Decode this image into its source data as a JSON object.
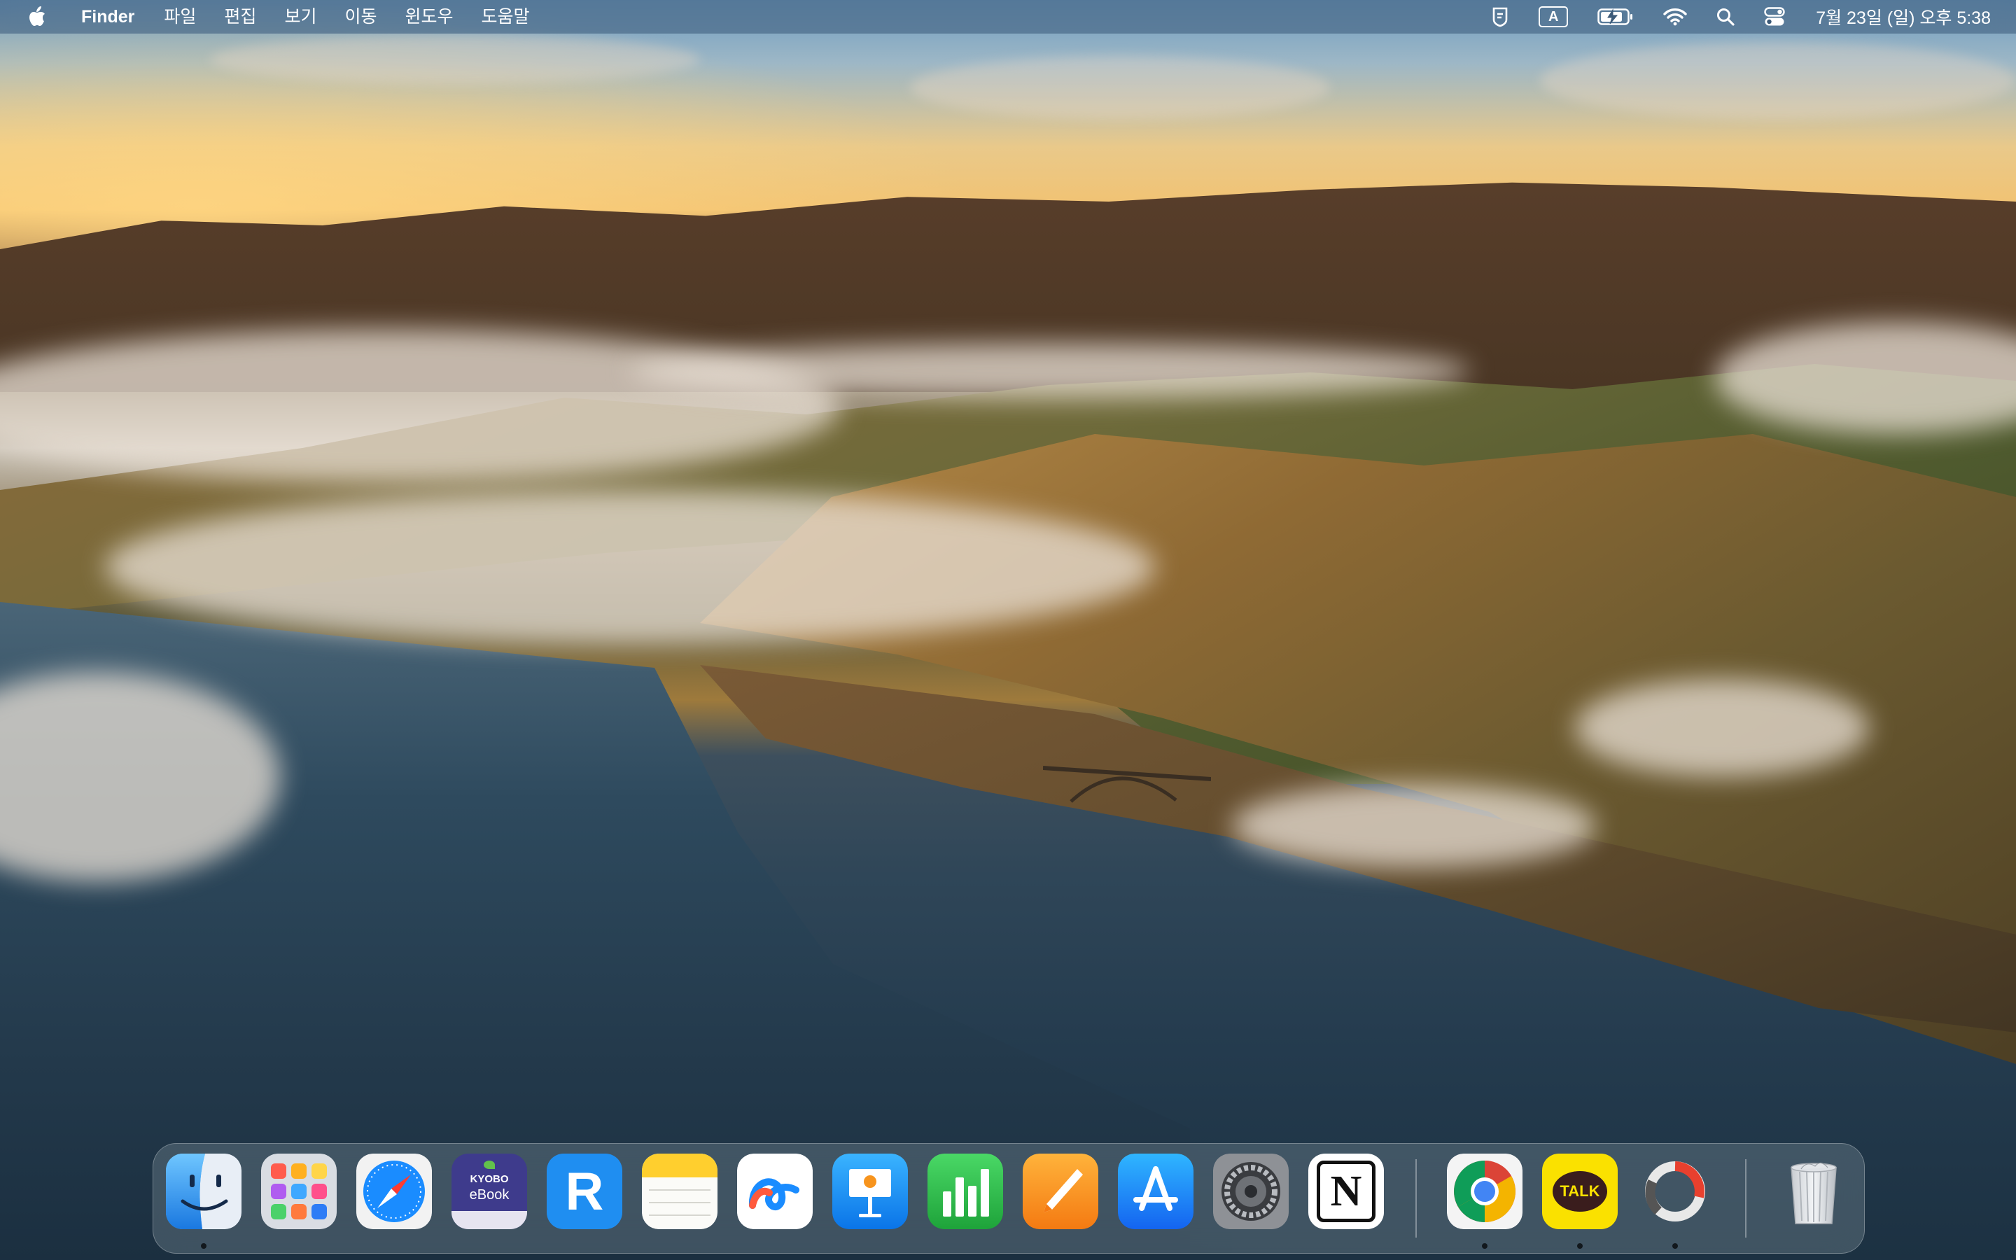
{
  "menubar": {
    "apple_icon": "apple-logo-icon",
    "app_name": "Finder",
    "menus": [
      "파일",
      "편집",
      "보기",
      "이동",
      "윈도우",
      "도움말"
    ],
    "status_icons": [
      "shield-clipboard-icon",
      "input-source-icon",
      "battery-charging-icon",
      "wifi-icon",
      "spotlight-search-icon",
      "control-center-icon"
    ],
    "input_source_label": "A",
    "clock": "7월 23일 (일) 오후 5:38"
  },
  "dock": {
    "apps": [
      {
        "name": "Finder",
        "icon": "finder-icon",
        "running": true
      },
      {
        "name": "Launchpad",
        "icon": "launchpad-icon",
        "running": false
      },
      {
        "name": "Safari",
        "icon": "safari-icon",
        "running": false
      },
      {
        "name": "교보eBook",
        "icon": "kyobo-ebook-icon",
        "label_top": "KYOBO",
        "label_bottom": "eBook",
        "running": false
      },
      {
        "name": "R",
        "icon": "r-app-icon",
        "letter": "R",
        "running": false
      },
      {
        "name": "Notes",
        "icon": "notes-icon",
        "running": false
      },
      {
        "name": "Freeform",
        "icon": "freeform-icon",
        "running": false
      },
      {
        "name": "Keynote",
        "icon": "keynote-icon",
        "running": false
      },
      {
        "name": "Numbers",
        "icon": "numbers-icon",
        "running": false
      },
      {
        "name": "Pages",
        "icon": "pages-icon",
        "running": false
      },
      {
        "name": "App Store",
        "icon": "app-store-icon",
        "running": false
      },
      {
        "name": "System Settings",
        "icon": "system-settings-icon",
        "running": false
      },
      {
        "name": "Notion",
        "icon": "notion-icon",
        "letter": "N",
        "running": false
      },
      {
        "name": "Chrome",
        "icon": "chrome-icon",
        "running": true
      },
      {
        "name": "KakaoTalk",
        "icon": "kakaotalk-icon",
        "label": "TALK",
        "running": true
      },
      {
        "name": "Activity",
        "icon": "activity-ring-icon",
        "running": true
      }
    ],
    "trash": {
      "name": "Trash",
      "icon": "trash-icon"
    }
  },
  "colors": {
    "menubar_bg": "#3c5a78",
    "dock_bg": "#788c96",
    "chrome_red": "#db4437",
    "chrome_yellow": "#f4b400",
    "chrome_green": "#0f9d58",
    "chrome_blue": "#4285f4",
    "kakao_yellow": "#fae100",
    "numbers_green": "#2fbf4a",
    "pages_orange": "#f7941d",
    "appstore_blue": "#1a8cff",
    "r_blue": "#1f8ef1"
  }
}
